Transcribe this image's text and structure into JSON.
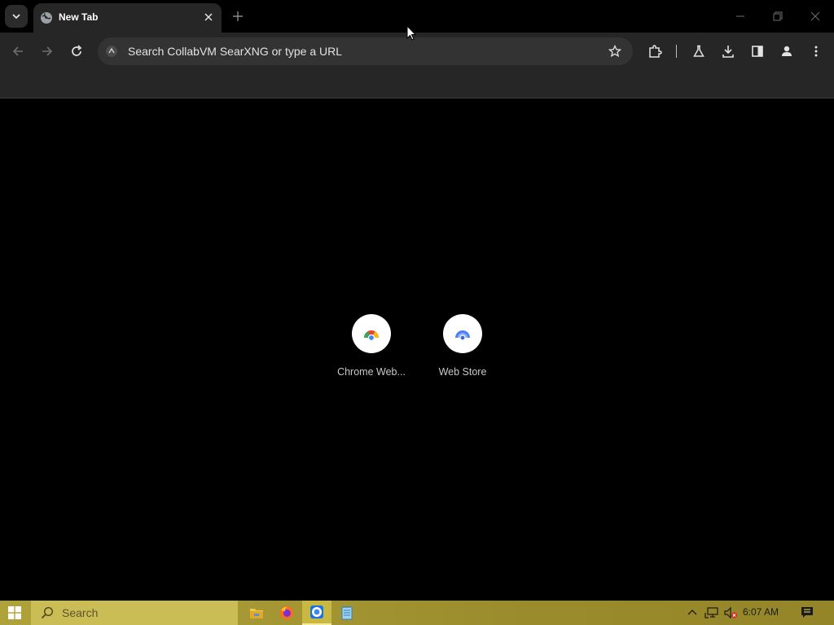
{
  "browser": {
    "tab": {
      "title": "New Tab"
    },
    "omnibox": {
      "placeholder": "Search CollabVM SearXNG or type a URL"
    }
  },
  "new_tab_page": {
    "shortcuts": [
      {
        "label": "Chrome Web..."
      },
      {
        "label": "Web Store"
      }
    ]
  },
  "taskbar": {
    "search_placeholder": "Search",
    "clock": "6:07 AM",
    "accent_color": "#b0a23a"
  },
  "icons": [
    "tab-search-icon",
    "globe-icon",
    "close-icon",
    "plus-icon",
    "minimize-icon",
    "restore-icon",
    "back-icon",
    "forward-icon",
    "reload-icon",
    "site-info-icon",
    "star-icon",
    "extensions-icon",
    "labs-icon",
    "download-icon",
    "side-panel-icon",
    "profile-icon",
    "menu-icon",
    "windows-start-icon",
    "search-icon",
    "file-explorer-icon",
    "firefox-icon",
    "chrome-icon",
    "notepad-icon",
    "chevron-up-icon",
    "network-icon",
    "volume-muted-icon",
    "action-center-icon"
  ]
}
